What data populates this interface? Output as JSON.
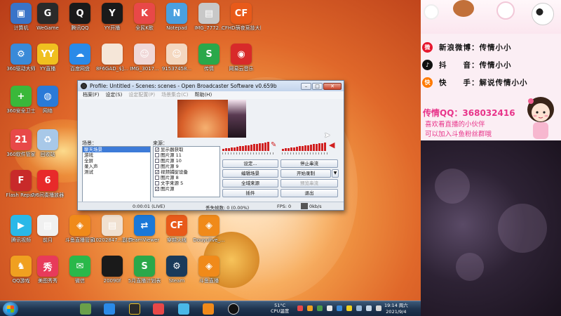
{
  "desktop_icons": [
    {
      "label": "计算机",
      "color": "#3a74c8",
      "glyph": "▣"
    },
    {
      "label": "WeGame",
      "color": "#2a2a2a",
      "glyph": "G"
    },
    {
      "label": "腾讯QQ",
      "color": "#1a1a1a",
      "glyph": "Q"
    },
    {
      "label": "YY开播",
      "color": "#1a1a1a",
      "glyph": "Y"
    },
    {
      "label": "全民K歌",
      "color": "#e84848",
      "glyph": "K"
    },
    {
      "label": "Notepad",
      "color": "#4aa0e0",
      "glyph": "N"
    },
    {
      "label": "IMG_7772...",
      "color": "#c8c8c8",
      "glyph": "▤"
    },
    {
      "label": "CFHD萌夜竞技大区",
      "color": "#e85a1a",
      "glyph": "CF"
    },
    {
      "label": "360驱动大师",
      "color": "#3a8ad8",
      "glyph": "⚙"
    },
    {
      "label": "YY直播",
      "color": "#f0c020",
      "glyph": "YY"
    },
    {
      "label": "百度网盘",
      "color": "#2a8ae8",
      "glyph": "☁"
    },
    {
      "label": "8F6GAD_$]...",
      "color": "#f5e6d8",
      "glyph": ""
    },
    {
      "label": "IMG_3017...",
      "color": "#f0d8d8",
      "glyph": "☺"
    },
    {
      "label": "91537458...",
      "color": "#f4d8c0",
      "glyph": "☺"
    },
    {
      "label": "传情",
      "color": "#2aa84a",
      "glyph": "S"
    },
    {
      "label": "网易云音乐",
      "color": "#d82a2a",
      "glyph": "◉"
    },
    {
      "label": "360安全卫士",
      "color": "#3ab83a",
      "glyph": "+"
    },
    {
      "label": "网络",
      "color": "#2a7ad8",
      "glyph": "◍"
    },
    {
      "label": "360软件管家",
      "color": "#e84848",
      "glyph": "21"
    },
    {
      "label": "回收站",
      "color": "#a8c8e8",
      "glyph": "♻"
    },
    {
      "label": "Flash Repair",
      "color": "#c82a2a",
      "glyph": "F"
    },
    {
      "label": "7/6间奏播放器",
      "color": "#e82a2a",
      "glyph": "6"
    },
    {
      "label": "腾讯视频",
      "color": "#2ab8e8",
      "glyph": "▶"
    },
    {
      "label": "前月",
      "color": "#f0f0f0",
      "glyph": "▤"
    },
    {
      "label": "斗鱼直播管家",
      "color": "#f08a1a",
      "glyph": "◈"
    },
    {
      "label": "10202847...副本",
      "color": "#f0e0d0",
      "glyph": "▤"
    },
    {
      "label": "TeamViewer",
      "color": "#1a78d8",
      "glyph": "⇄"
    },
    {
      "label": "穿越火线",
      "color": "#e85a1a",
      "glyph": "CF"
    },
    {
      "label": "Douyulive_...",
      "color": "#f08a1a",
      "glyph": "◈"
    },
    {
      "label": "QQ游戏",
      "color": "#f0a020",
      "glyph": "♞"
    },
    {
      "label": "美图秀秀",
      "color": "#e83a5a",
      "glyph": "秀"
    },
    {
      "label": "微信",
      "color": "#2ab84a",
      "glyph": "✉"
    },
    {
      "label": "20090f",
      "color": "#1a1a1a",
      "glyph": ""
    },
    {
      "label": "5月直播计划表",
      "color": "#2aa84a",
      "glyph": "S"
    },
    {
      "label": "Steam",
      "color": "#1a3a5a",
      "glyph": "⚙"
    },
    {
      "label": "斗鱼直播",
      "color": "#f08a1a",
      "glyph": "◈"
    }
  ],
  "obs": {
    "title": "Profile: Untitled - Scenes: scenes - Open Broadcaster Software v0.659b",
    "menu": [
      {
        "label": "档案(F)",
        "disabled": false
      },
      {
        "label": "设定(S)",
        "disabled": false
      },
      {
        "label": "设定配置(P)",
        "disabled": true
      },
      {
        "label": "场景集合(C)",
        "disabled": true
      },
      {
        "label": "帮助(H)",
        "disabled": false
      }
    ],
    "scenes_label": "场景：",
    "scenes": [
      "聊天场景",
      "游戏",
      "全屏",
      "录入声",
      "测试"
    ],
    "sources_label": "来源：",
    "sources": [
      {
        "label": "显示器获取",
        "checked": true
      },
      {
        "label": "图片源 11",
        "checked": false
      },
      {
        "label": "图片源 10",
        "checked": false
      },
      {
        "label": "图片源 9",
        "checked": false
      },
      {
        "label": "视频捕捉设备",
        "checked": true
      },
      {
        "label": "图片源 8",
        "checked": false
      },
      {
        "label": "文字来源 5",
        "checked": false
      },
      {
        "label": "图片源",
        "checked": true
      }
    ],
    "buttons": {
      "settings": "设定...",
      "stop_stream": "停止串流",
      "edit_scene": "编辑场景",
      "start_record": "开始录制",
      "global_sources": "全域来源",
      "preview_stream": "预览串流",
      "plugins": "插件",
      "exit": "退出"
    },
    "status": {
      "time": "0:00:01 (LIVE)",
      "dropped": "丢失帧数: 0 (0.00%)",
      "fps": "FPS: 0",
      "bitrate": "0kb/s"
    }
  },
  "taskbar": {
    "weather_temp": "51°C",
    "weather_label": "CPU温度",
    "clock_time": "19:14 周六",
    "clock_date": "2021/9/4"
  },
  "overlay": {
    "social": [
      {
        "icon": "weibo-icon",
        "glyph": "微",
        "color": "#e6162d",
        "text": "新浪微博：传情小小"
      },
      {
        "icon": "douyin-icon",
        "glyph": "♪",
        "color": "#111111",
        "text": "抖　　音：传情小小"
      },
      {
        "icon": "kuaishou-icon",
        "glyph": "快",
        "color": "#ff7a00",
        "text": "快　　手：解说传情小小"
      }
    ],
    "qq": "传情QQ：368032416",
    "message_1": "喜欢看直播的小伙伴",
    "message_2": "可以加入斗鱼粉丝群哦"
  }
}
